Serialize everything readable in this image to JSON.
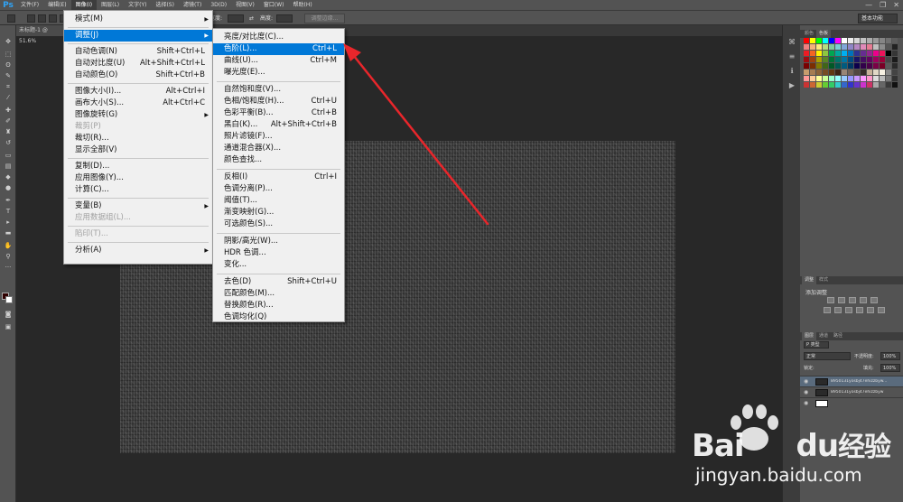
{
  "app": {
    "logo": "Ps"
  },
  "menubar": {
    "items": [
      "文件(F)",
      "编辑(E)",
      "图像(I)",
      "图层(L)",
      "文字(Y)",
      "选择(S)",
      "滤镜(T)",
      "3D(D)",
      "视图(V)",
      "窗口(W)",
      "帮助(H)"
    ],
    "active_index": 2
  },
  "window_controls": {
    "minimize": "—",
    "restore": "❐",
    "close": "✕"
  },
  "optionsbar": {
    "refine_edge": "调整边缘...",
    "workspace": "基本功能",
    "width_label": "宽度:",
    "height_label": "高度:"
  },
  "document": {
    "tab_title": "未标题-1 @ 51.6%"
  },
  "image_menu": {
    "items": [
      {
        "label": "模式(M)",
        "shortcut": "",
        "submenu": true,
        "disabled": false
      },
      {
        "sep": true
      },
      {
        "label": "调整(J)",
        "shortcut": "",
        "submenu": true,
        "disabled": false,
        "highlight": true
      },
      {
        "sep": true
      },
      {
        "label": "自动色调(N)",
        "shortcut": "Shift+Ctrl+L",
        "disabled": false
      },
      {
        "label": "自动对比度(U)",
        "shortcut": "Alt+Shift+Ctrl+L",
        "disabled": false
      },
      {
        "label": "自动颜色(O)",
        "shortcut": "Shift+Ctrl+B",
        "disabled": false
      },
      {
        "sep": true
      },
      {
        "label": "图像大小(I)...",
        "shortcut": "Alt+Ctrl+I",
        "disabled": false
      },
      {
        "label": "画布大小(S)...",
        "shortcut": "Alt+Ctrl+C",
        "disabled": false
      },
      {
        "label": "图像旋转(G)",
        "shortcut": "",
        "submenu": true,
        "disabled": false
      },
      {
        "label": "裁剪(P)",
        "shortcut": "",
        "disabled": true
      },
      {
        "label": "裁切(R)...",
        "shortcut": "",
        "disabled": false
      },
      {
        "label": "显示全部(V)",
        "shortcut": "",
        "disabled": false
      },
      {
        "sep": true
      },
      {
        "label": "复制(D)...",
        "shortcut": "",
        "disabled": false
      },
      {
        "label": "应用图像(Y)...",
        "shortcut": "",
        "disabled": false
      },
      {
        "label": "计算(C)...",
        "shortcut": "",
        "disabled": false
      },
      {
        "sep": true
      },
      {
        "label": "变量(B)",
        "shortcut": "",
        "submenu": true,
        "disabled": false
      },
      {
        "label": "应用数据组(L)...",
        "shortcut": "",
        "disabled": true
      },
      {
        "sep": true
      },
      {
        "label": "陷印(T)...",
        "shortcut": "",
        "disabled": true
      },
      {
        "sep": true
      },
      {
        "label": "分析(A)",
        "shortcut": "",
        "submenu": true,
        "disabled": false
      }
    ]
  },
  "adjust_menu": {
    "items": [
      {
        "label": "亮度/对比度(C)...",
        "shortcut": ""
      },
      {
        "label": "色阶(L)...",
        "shortcut": "Ctrl+L",
        "highlight": true
      },
      {
        "label": "曲线(U)...",
        "shortcut": "Ctrl+M"
      },
      {
        "label": "曝光度(E)...",
        "shortcut": ""
      },
      {
        "sep": true
      },
      {
        "label": "自然饱和度(V)...",
        "shortcut": ""
      },
      {
        "label": "色相/饱和度(H)...",
        "shortcut": "Ctrl+U"
      },
      {
        "label": "色彩平衡(B)...",
        "shortcut": "Ctrl+B"
      },
      {
        "label": "黑白(K)...",
        "shortcut": "Alt+Shift+Ctrl+B"
      },
      {
        "label": "照片滤镜(F)...",
        "shortcut": ""
      },
      {
        "label": "通道混合器(X)...",
        "shortcut": ""
      },
      {
        "label": "颜色查找...",
        "shortcut": ""
      },
      {
        "sep": true
      },
      {
        "label": "反相(I)",
        "shortcut": "Ctrl+I"
      },
      {
        "label": "色调分离(P)...",
        "shortcut": ""
      },
      {
        "label": "阈值(T)...",
        "shortcut": ""
      },
      {
        "label": "渐变映射(G)...",
        "shortcut": ""
      },
      {
        "label": "可选颜色(S)...",
        "shortcut": ""
      },
      {
        "sep": true
      },
      {
        "label": "阴影/高光(W)...",
        "shortcut": ""
      },
      {
        "label": "HDR 色调...",
        "shortcut": ""
      },
      {
        "label": "变化...",
        "shortcut": ""
      },
      {
        "sep": true
      },
      {
        "label": "去色(D)",
        "shortcut": "Shift+Ctrl+U"
      },
      {
        "label": "匹配颜色(M)...",
        "shortcut": ""
      },
      {
        "label": "替换颜色(R)...",
        "shortcut": ""
      },
      {
        "label": "色调均化(Q)",
        "shortcut": ""
      }
    ]
  },
  "panels": {
    "swatches_tabs": [
      "颜色",
      "色板"
    ],
    "adjust_tabs": [
      "调整",
      "样式"
    ],
    "adjust_title": "添加调整",
    "layers_tabs": [
      "图层",
      "通道",
      "路径"
    ],
    "layer_kind": "P 类型",
    "blend_mode": "正常",
    "opacity_label": "不透明度:",
    "opacity_value": "100%",
    "lock_label": "锁定:",
    "fill_label": "填充:",
    "fill_value": "100%",
    "layers": [
      {
        "name": "8950131yosbj47ehizzbyw...",
        "selected": true
      },
      {
        "name": "8950131yosbj47ehizzbyw",
        "selected": false
      },
      {
        "name": "",
        "selected": false,
        "white": true
      }
    ]
  },
  "watermark": {
    "logo": "Bai",
    "logo2": "du",
    "logo_cn": "经验",
    "url": "jingyan.baidu.com"
  },
  "colors": {
    "highlight": "#0078d7",
    "arrow": "#e8262b",
    "fg": "#300000",
    "bg": "#ffffff"
  }
}
